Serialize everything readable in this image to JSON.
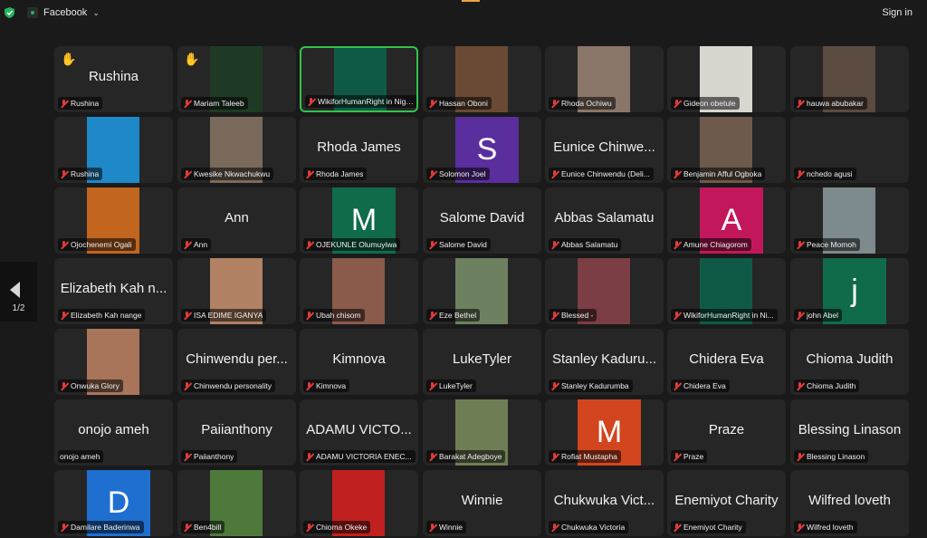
{
  "topbar": {
    "app_label": "Facebook",
    "signin_label": "Sign in"
  },
  "pager": {
    "page": "1/2"
  },
  "tiles": [
    {
      "name": "Rushina",
      "big": "Rushina",
      "hand": true
    },
    {
      "name": "Mariam Taleeb",
      "video": "#1f3a24",
      "hand": true
    },
    {
      "name": "WikiforHumanRight in Nige...",
      "video": "#0f5a47",
      "active": true
    },
    {
      "name": "Hassan Oboni",
      "video": "#6a4a34"
    },
    {
      "name": "Rhoda Ochiwu",
      "video": "#8a7668"
    },
    {
      "name": "Gideon obetule",
      "video": "#d9d6d0"
    },
    {
      "name": "hauwa abubakar",
      "video": "#5b4a40"
    },
    {
      "name": "Rushina",
      "video": "#1e88c8"
    },
    {
      "name": "Kwesike Nkwachukwu",
      "video": "#7a6a5c"
    },
    {
      "name": "Rhoda James",
      "big": "Rhoda James"
    },
    {
      "name": "Solomon Joel",
      "avatar": "S",
      "avatar_color": "#5b2e9e"
    },
    {
      "name": "Eunice Chinwendu (Deli...",
      "big": "Eunice Chinwe..."
    },
    {
      "name": "Benjamin Afful Ogboka",
      "video": "#6d5a4c"
    },
    {
      "name": "nchedo agusi"
    },
    {
      "name": "Ojochenemi Ogali",
      "video": "#c1651f"
    },
    {
      "name": "Ann",
      "big": "Ann"
    },
    {
      "name": "OJEKUNLE Olumuyiwa",
      "avatar": "M",
      "avatar_color": "#0f6b4a"
    },
    {
      "name": "Salome David",
      "big": "Salome David"
    },
    {
      "name": "Abbas Salamatu",
      "big": "Abbas Salamatu"
    },
    {
      "name": "Amune Chiagorom",
      "avatar": "A",
      "avatar_color": "#c2185b"
    },
    {
      "name": "Peace Momoh",
      "video": "#7d8a8e"
    },
    {
      "name": "Elizabeth Kah nange",
      "big": "Elizabeth Kah n..."
    },
    {
      "name": "ISA EDIME IGANYA",
      "video": "#b18263"
    },
    {
      "name": "Ubah chisom",
      "video": "#8a5a4a"
    },
    {
      "name": "Eze Bethel",
      "video": "#6d8060"
    },
    {
      "name": "Blessed -",
      "video": "#7a3e44"
    },
    {
      "name": "WikiforHumanRight in Ni...",
      "video": "#0f5a47"
    },
    {
      "name": "john Abel",
      "avatar": "j",
      "avatar_color": "#0f6b4a"
    },
    {
      "name": "Onwuka Glory",
      "video": "#a8745a"
    },
    {
      "name": "Chinwendu personality",
      "big": "Chinwendu per..."
    },
    {
      "name": "Kimnova",
      "big": "Kimnova"
    },
    {
      "name": "LukeTyler",
      "big": "LukeTyler"
    },
    {
      "name": "Stanley Kadurumba",
      "big": "Stanley Kaduru..."
    },
    {
      "name": "Chidera Eva",
      "big": "Chidera Eva"
    },
    {
      "name": "Chioma Judith",
      "big": "Chioma Judith"
    },
    {
      "name": "onojo ameh",
      "big": "onojo ameh",
      "nomic": true
    },
    {
      "name": "Paiianthony",
      "big": "Paiianthony"
    },
    {
      "name": "ADAMU VICTORIA ENEC...",
      "big": "ADAMU VICTO..."
    },
    {
      "name": "Barakat Adegboye",
      "video": "#6f7d55"
    },
    {
      "name": "Rofiat Mustapha",
      "avatar": "M",
      "avatar_color": "#d2451e"
    },
    {
      "name": "Praze",
      "big": "Praze"
    },
    {
      "name": "Blessing Linason",
      "big": "Blessing Linason"
    },
    {
      "name": "Damilare Baderinwa",
      "avatar": "D",
      "avatar_color": "#1f6fd1"
    },
    {
      "name": "Ben4bill",
      "video": "#4d7a3a"
    },
    {
      "name": "Chioma Okeke",
      "video": "#c0201f"
    },
    {
      "name": "Winnie",
      "big": "Winnie"
    },
    {
      "name": "Chukwuka Victoria",
      "big": "Chukwuka Vict..."
    },
    {
      "name": "Enemiyot Charity",
      "big": "Enemiyot Charity"
    },
    {
      "name": "Wilfred loveth",
      "big": "Wilfred loveth"
    }
  ]
}
